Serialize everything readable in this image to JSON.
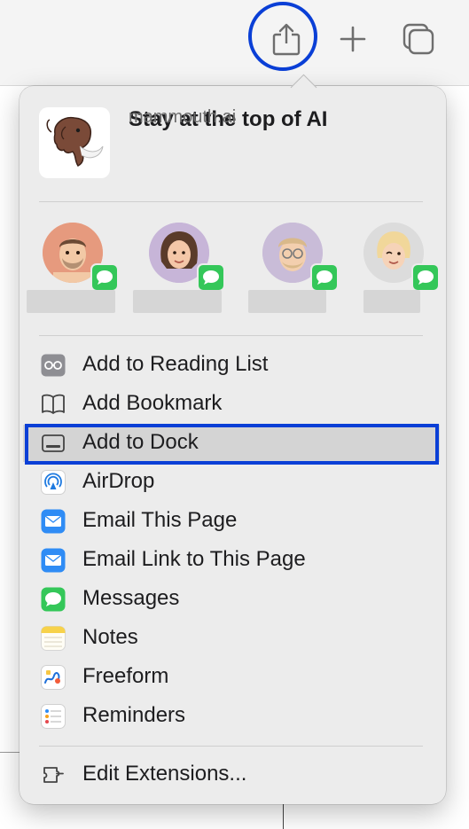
{
  "toolbar": {
    "share_icon": "share-icon",
    "new_tab_icon": "plus-icon",
    "tabs_icon": "tab-overview-icon"
  },
  "share_sheet": {
    "page": {
      "title": "Stay at the top of AI",
      "url": "mammouth.ai",
      "thumbnail_icon": "mammoth-logo"
    },
    "contacts": [
      {
        "avatar": "memoji-man-beard",
        "badge": "messages-icon"
      },
      {
        "avatar": "memoji-woman-brown-hair",
        "badge": "messages-icon"
      },
      {
        "avatar": "memoji-man-glasses",
        "badge": "messages-icon"
      },
      {
        "avatar": "memoji-blonde-wink",
        "badge": "messages-icon"
      }
    ],
    "menu_items": [
      {
        "label": "Add to Reading List",
        "icon": "reading-list-icon"
      },
      {
        "label": "Add Bookmark",
        "icon": "book-icon"
      },
      {
        "label": "Add to Dock",
        "icon": "dock-icon"
      },
      {
        "label": "AirDrop",
        "icon": "airdrop-icon"
      },
      {
        "label": "Email This Page",
        "icon": "mail-icon"
      },
      {
        "label": "Email Link to This Page",
        "icon": "mail-icon"
      },
      {
        "label": "Messages",
        "icon": "messages-icon"
      },
      {
        "label": "Notes",
        "icon": "notes-icon"
      },
      {
        "label": "Freeform",
        "icon": "freeform-icon"
      },
      {
        "label": "Reminders",
        "icon": "reminders-icon"
      }
    ],
    "footer_item": {
      "label": "Edit Extensions...",
      "icon": "extensions-icon"
    },
    "selected_item": "Add to Dock"
  },
  "colors": {
    "highlight": "#0a3fd6",
    "messages_green": "#34c759",
    "menu_background": "#ececec"
  }
}
